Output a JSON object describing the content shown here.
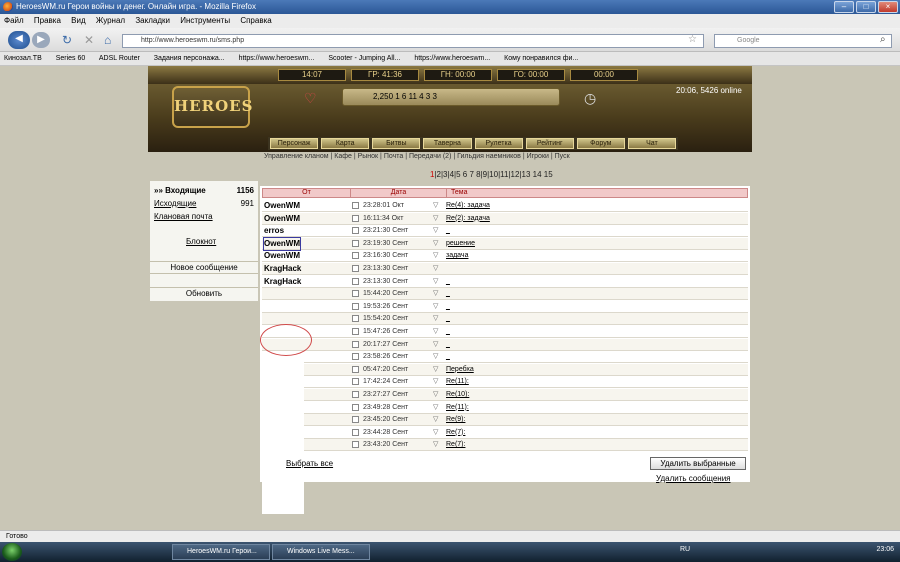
{
  "browser": {
    "title": "HeroesWM.ru Герои войны и денег. Онлайн игра. - Mozilla Firefox",
    "menu": [
      "Файл",
      "Правка",
      "Вид",
      "Журнал",
      "Закладки",
      "Инструменты",
      "Справка"
    ],
    "url": "http://www.heroeswm.ru/sms.php",
    "search_placeholder": "Google",
    "bookmarks": [
      "Кинозал.ТВ",
      "Series 60",
      "ADSL Router",
      "Задания персонажа...",
      "https://www.heroeswm...",
      "Scooter - Jumping All...",
      "https://www.heroeswm...",
      "Кому понравился фи..."
    ],
    "status": "Готово"
  },
  "game": {
    "timers": [
      "14:07",
      "ГР: 41:36",
      "ГН: 00:00",
      "ГО: 00:00",
      "00:00"
    ],
    "logo": "HEROES",
    "resources": "2,250   1   6   11   4   3   3",
    "online": "20:06, 5426 online",
    "nav": [
      "Персонаж",
      "Карта",
      "Битвы",
      "Таверна",
      "Рулетка",
      "Рейтинг",
      "Форум",
      "Чат"
    ],
    "sublinks": "Управление кланом | Кафе | Рынок | Почта | Передачи (2) | Гильдия наемников | Игроки | Пуск",
    "pager_current": "1",
    "pager_rest": "|2|3|4|5 6 7 8|9|10|11|12|13 14 15",
    "side": {
      "inbox_label": "»» Входящие",
      "inbox_count": "1156",
      "outbox_label": "Исходящие",
      "outbox_count": "991",
      "clan_mail": "Клановая почта",
      "notepad": "Блокнот",
      "new_message": "Новое сообщение",
      "refresh": "Обновить"
    },
    "table": {
      "col_from": "От",
      "col_date": "Дата",
      "col_subject": "Тема",
      "rows": [
        {
          "from": "OwenWM",
          "date": "23:28:01 Окт",
          "subj": "Re(4): задача"
        },
        {
          "from": "OwenWM",
          "date": "16:11:34 Окт",
          "subj": "Re(2): задача"
        },
        {
          "from": "erros",
          "date": "23:21:30 Сент",
          "subj": "_"
        },
        {
          "from": "OwenWM",
          "date": "23:19:30 Сент",
          "subj": "решение"
        },
        {
          "from": "OwenWM",
          "date": "23:16:30 Сент",
          "subj": "задача"
        },
        {
          "from": "KragHack",
          "date": "23:13:30 Сент",
          "subj": ""
        },
        {
          "from": "KragHack",
          "date": "23:13:30 Сент",
          "subj": "_"
        },
        {
          "from": "",
          "date": "15:44:20 Сент",
          "subj": "_"
        },
        {
          "from": "",
          "date": "19:53:26 Сент",
          "subj": "_"
        },
        {
          "from": "",
          "date": "15:54:20 Сент",
          "subj": "_"
        },
        {
          "from": "",
          "date": "15:47:26 Сент",
          "subj": "_"
        },
        {
          "from": "",
          "date": "20:17:27 Сент",
          "subj": "_"
        },
        {
          "from": "",
          "date": "23:58:26 Сент",
          "subj": "_"
        },
        {
          "from": "",
          "date": "05:47:20 Сент",
          "subj": "Перебха"
        },
        {
          "from": "",
          "date": "17:42:24 Сент",
          "subj": "Re(11):"
        },
        {
          "from": "",
          "date": "23:27:27 Сент",
          "subj": "Re(10):"
        },
        {
          "from": "",
          "date": "23:49:28 Сент",
          "subj": "Re(11):"
        },
        {
          "from": "",
          "date": "23:45:20 Сент",
          "subj": "Re(9):"
        },
        {
          "from": "",
          "date": "23:44:28 Сент",
          "subj": "Re(7):"
        },
        {
          "from": "",
          "date": "23:43:20 Сент",
          "subj": "Re(7):"
        }
      ],
      "select_all": "Выбрать все",
      "delete_selected": "Удалить выбранные",
      "delete_messages": "Удалить сообщения"
    }
  },
  "taskbar": {
    "tasks": [
      "HeroesWM.ru Герои...",
      "Windows Live Mess..."
    ],
    "lang": "RU",
    "clock": "23:06"
  }
}
